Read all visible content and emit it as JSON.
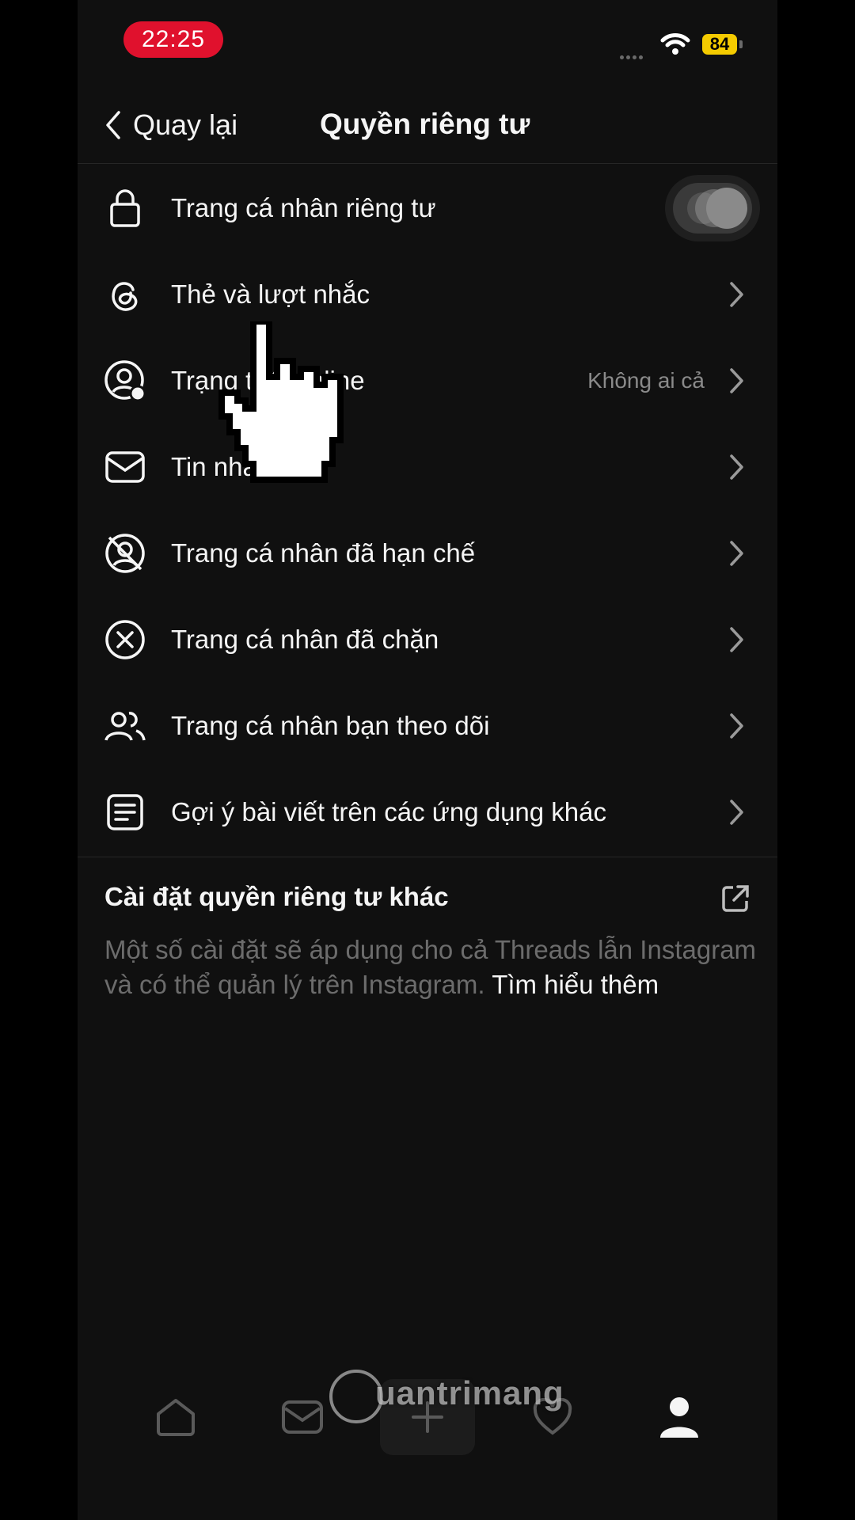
{
  "status_bar": {
    "time": "22:25",
    "battery": "84"
  },
  "header": {
    "back_label": "Quay lại",
    "title": "Quyền riêng tư"
  },
  "items": [
    {
      "label": "Trang cá nhân riêng tư",
      "icon": "lock-icon",
      "control": "toggle"
    },
    {
      "label": "Thẻ và lượt nhắc",
      "icon": "threads-icon",
      "control": "chevron"
    },
    {
      "label": "Trạng thái online",
      "icon": "online-status-icon",
      "value": "Không ai cả",
      "control": "chevron"
    },
    {
      "label": "Tin nhắn",
      "icon": "mail-icon",
      "control": "chevron"
    },
    {
      "label": "Trang cá nhân đã hạn chế",
      "icon": "restricted-icon",
      "control": "chevron"
    },
    {
      "label": "Trang cá nhân đã chặn",
      "icon": "blocked-icon",
      "control": "chevron"
    },
    {
      "label": "Trang cá nhân bạn theo dõi",
      "icon": "following-icon",
      "control": "chevron"
    },
    {
      "label": "Gợi ý bài viết trên các ứng dụng khác",
      "icon": "document-icon",
      "control": "chevron"
    }
  ],
  "other_settings": {
    "title": "Cài đặt quyền riêng tư khác",
    "description": "Một số cài đặt sẽ áp dụng cho cả Threads lẫn Instagram và có thể quản lý trên Instagram.",
    "learn_more": "Tìm hiểu thêm"
  },
  "bottom_nav": [
    "home-icon",
    "inbox-icon",
    "plus-icon",
    "heart-icon",
    "profile-icon"
  ],
  "watermark": "uantrimang",
  "colors": {
    "background": "#101010",
    "time_pill": "#e0112d",
    "battery": "#f4cb00",
    "muted_text": "#6c6c6c"
  }
}
